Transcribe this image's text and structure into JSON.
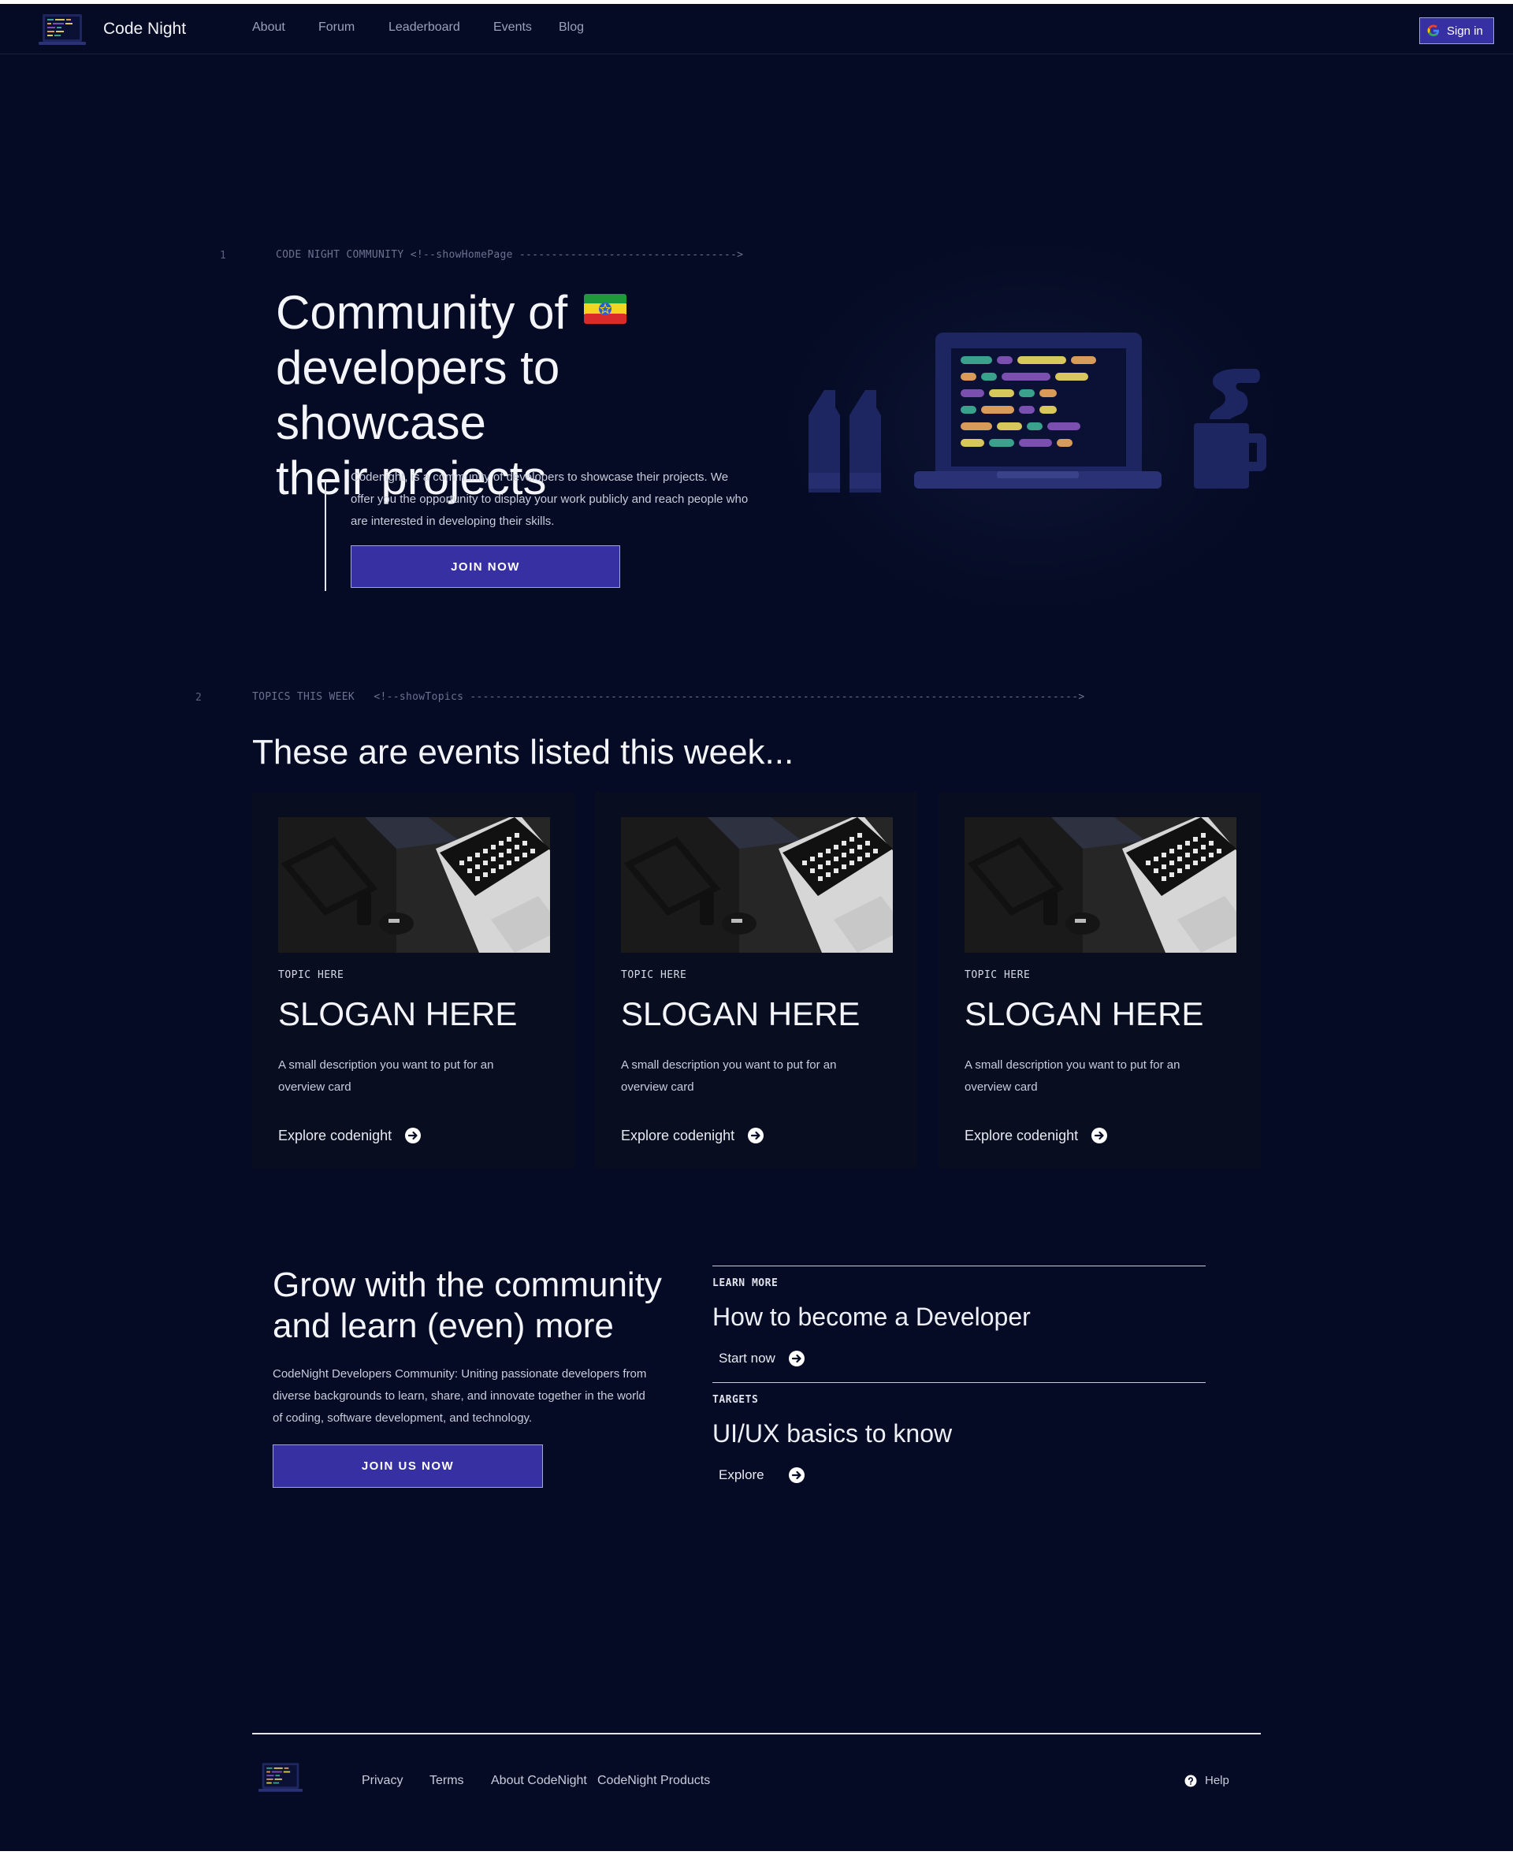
{
  "header": {
    "brand": "Code Night",
    "nav": [
      "About",
      "Forum",
      "Leaderboard",
      "Events",
      "Blog"
    ],
    "signin_label": "Sign in"
  },
  "hero": {
    "line_number": "1",
    "comment_label": "CODE NIGHT COMMUNITY",
    "comment_code": "<!--showHomePage ---------------------------------->",
    "title_line1": "Community of",
    "title_line2": "developers to showcase",
    "title_line3": "their projects",
    "description": "Codenight, is a community of developers to showcase their projects. We offer you the opportunity to display your work publicly and reach people who are interested in developing their skills.",
    "cta": "JOIN NOW"
  },
  "topics": {
    "line_number": "2",
    "comment_label": "TOPICS THIS WEEK",
    "comment_code": "<!--showTopics ----------------------------------------------------------------------------------------------->",
    "title": "These are events listed this week...",
    "cards": [
      {
        "topic": "TOPIC HERE",
        "slogan": "SLOGAN HERE",
        "description": "A small  description you want to put for an overview card",
        "link": "Explore codenight"
      },
      {
        "topic": "TOPIC HERE",
        "slogan": "SLOGAN HERE",
        "description": "A small  description you want to put for an overview card",
        "link": "Explore codenight"
      },
      {
        "topic": "TOPIC HERE",
        "slogan": "SLOGAN HERE",
        "description": "A small  description you want to put for an overview card",
        "link": "Explore codenight"
      }
    ]
  },
  "grow": {
    "title_line1": "Grow with the community",
    "title_line2": "and learn (even) more",
    "description": "CodeNight Developers Community: Uniting passionate developers from diverse backgrounds to learn, share, and innovate together in the world of coding, software development, and technology.",
    "cta": "JOIN US NOW",
    "items": [
      {
        "kicker": "LEARN MORE",
        "title": "How to become a Developer",
        "link": "Start now"
      },
      {
        "kicker": "TARGETS",
        "title": "UI/UX basics to know",
        "link": "Explore"
      }
    ]
  },
  "footer": {
    "links": [
      "Privacy",
      "Terms",
      "About CodeNight",
      "CodeNight Products"
    ],
    "help": "Help"
  },
  "colors": {
    "background": "#050b24",
    "primary": "#3730a3",
    "card": "#080d20"
  }
}
